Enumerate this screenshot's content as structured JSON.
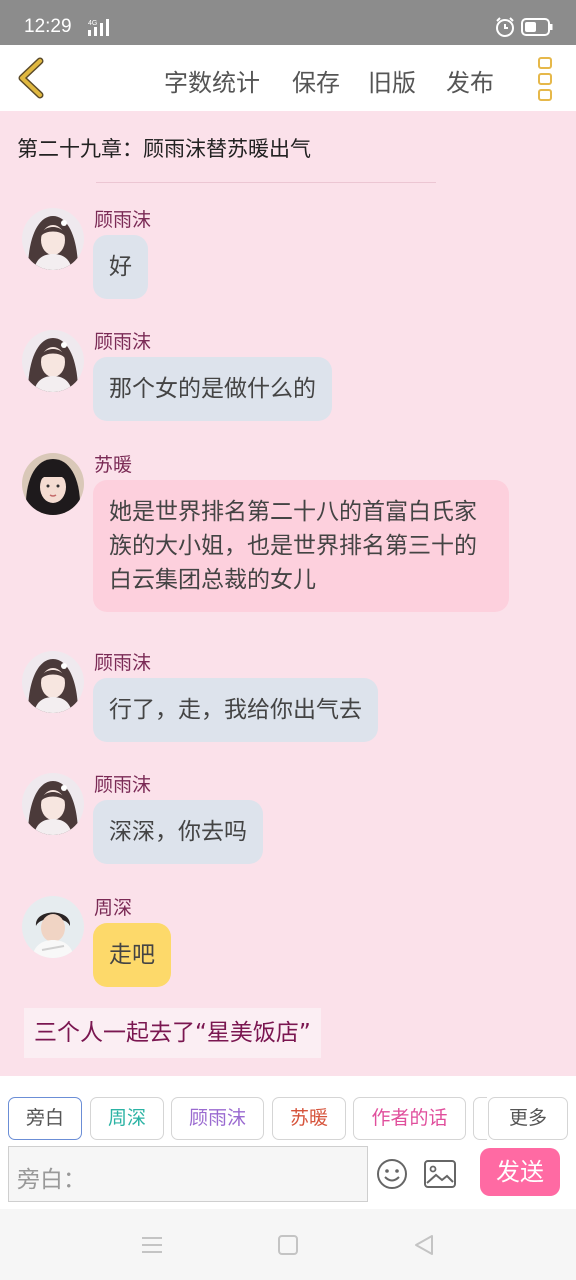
{
  "status_bar": {
    "time": "12:29",
    "network": "4G"
  },
  "top_bar": {
    "actions": [
      "字数统计",
      "保存",
      "旧版",
      "发布"
    ],
    "colors": {
      "back_icon": "#e0b840",
      "more_icon": "#e6b84a"
    }
  },
  "chapter": {
    "title": "第二十九章：顾雨沫替苏暖出气"
  },
  "messages": [
    {
      "sender": "顾雨沫",
      "text": "好"
    },
    {
      "sender": "顾雨沫",
      "text": "那个女的是做什么的"
    },
    {
      "sender": "苏暖",
      "text": "她是世界排名第二十八的首富白氏家族的大小姐，也是世界排名第三十的白云集团总裁的女儿"
    },
    {
      "sender": "顾雨沫",
      "text": "行了，走，我给你出气去"
    },
    {
      "sender": "顾雨沫",
      "text": "深深，你去吗"
    },
    {
      "sender": "周深",
      "text": "走吧"
    }
  ],
  "narration": "三个人一起去了“星美饭店”",
  "role_chips": [
    {
      "label": "旁白",
      "color": "#555555"
    },
    {
      "label": "周深",
      "color": "#2bb3a4"
    },
    {
      "label": "顾雨沫",
      "color": "#9a6ad0"
    },
    {
      "label": "苏暖",
      "color": "#d6543c"
    },
    {
      "label": "作者的话",
      "color": "#e04f9c"
    }
  ],
  "more_chip": "更多",
  "input": {
    "placeholder": "旁白："
  },
  "send_label": "发送",
  "colors": {
    "background": "#fbe1ea",
    "send_button": "#ff6aa3"
  }
}
